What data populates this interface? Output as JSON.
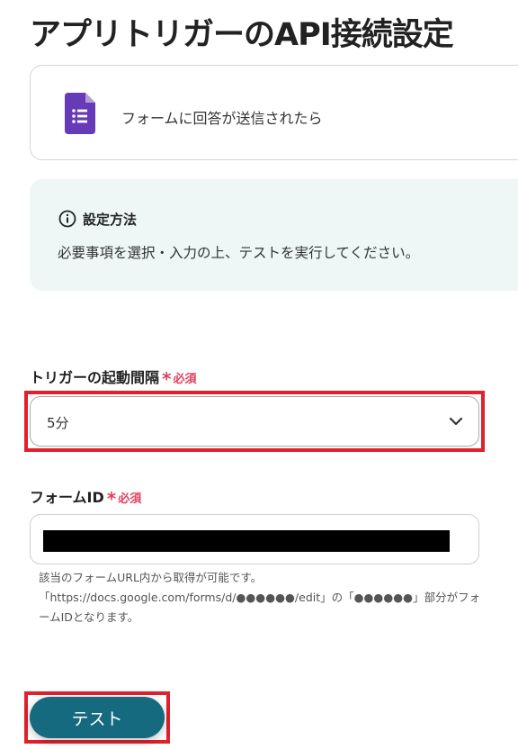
{
  "page_title": "アプリトリガーのAPI接続設定",
  "app_card": {
    "icon": "google-forms-icon",
    "label": "フォームに回答が送信されたら"
  },
  "info": {
    "icon": "info-icon",
    "title": "設定方法",
    "text": "必要事項を選択・入力の上、テストを実行してください。"
  },
  "interval_field": {
    "label": "トリガーの起動間隔",
    "required_mark": "*",
    "required_label": "必須",
    "value": "5分"
  },
  "form_id_field": {
    "label": "フォームID",
    "required_mark": "*",
    "required_label": "必須",
    "help_lines": [
      "該当のフォームURL内から取得が可能です。",
      "「https://docs.google.com/forms/d/●●●●●●/edit」の「●●●●●●」部分がフォ",
      "ームIDとなります。"
    ]
  },
  "test_button_label": "テスト",
  "colors": {
    "accent": "#156a80",
    "required": "#e0405e",
    "highlight": "#e0202c",
    "info_bg": "#eef7f6",
    "forms_purple": "#673ab7"
  }
}
